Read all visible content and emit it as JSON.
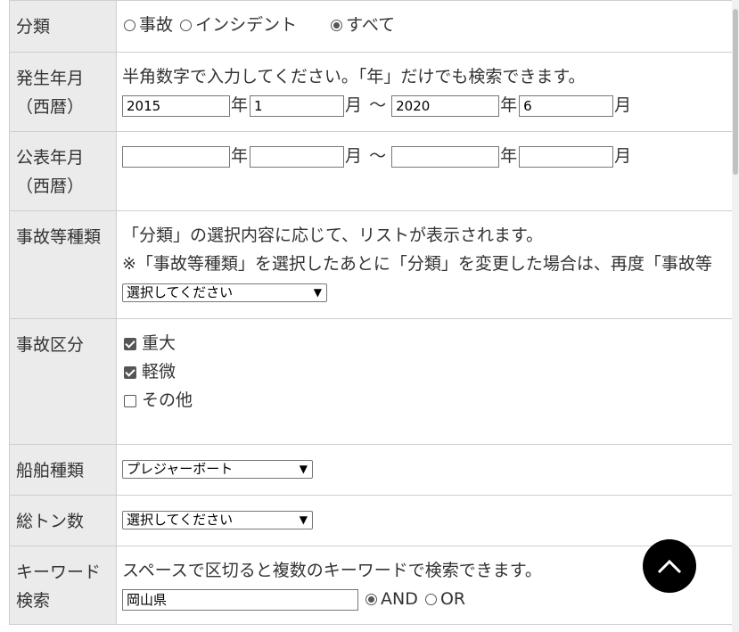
{
  "rows": {
    "category": {
      "label": "分類",
      "options": [
        "事故",
        "インシデント",
        "すべて"
      ],
      "selected": "すべて"
    },
    "occurrence": {
      "label_line1": "発生年月",
      "label_line2": "（西暦）",
      "hint": "半角数字で入力してください。「年」だけでも検索できます。",
      "from_year": "2015",
      "from_month": "1",
      "to_year": "2020",
      "to_month": "6",
      "year_unit": "年",
      "month_unit": "月",
      "range_sep": "～"
    },
    "published": {
      "label_line1": "公表年月",
      "label_line2": "（西暦）",
      "from_year": "",
      "from_month": "",
      "to_year": "",
      "to_month": "",
      "year_unit": "年",
      "month_unit": "月",
      "range_sep": "～"
    },
    "accident_type": {
      "label": "事故等種類",
      "hint1": "「分類」の選択内容に応じて、リストが表示されます。",
      "hint2": "※「事故等種類」を選択したあとに「分類」を変更した場合は、再度「事故等",
      "select_value": "選択してください"
    },
    "accident_class": {
      "label": "事故区分",
      "options": [
        {
          "label": "重大",
          "checked": true
        },
        {
          "label": "軽微",
          "checked": true
        },
        {
          "label": "その他",
          "checked": false
        }
      ]
    },
    "vessel_type": {
      "label": "船舶種類",
      "select_value": "プレジャーボート"
    },
    "tonnage": {
      "label": "総トン数",
      "select_value": "選択してください"
    },
    "keyword": {
      "label_line1": "キーワード",
      "label_line2": "検索",
      "hint": "スペースで区切ると複数のキーワードで検索できます。",
      "value": "岡山県",
      "modes": [
        "AND",
        "OR"
      ],
      "selected_mode": "AND"
    }
  },
  "icons": {
    "scroll_top": "chevron-up-icon",
    "dropdown": "chevron-down-icon"
  }
}
